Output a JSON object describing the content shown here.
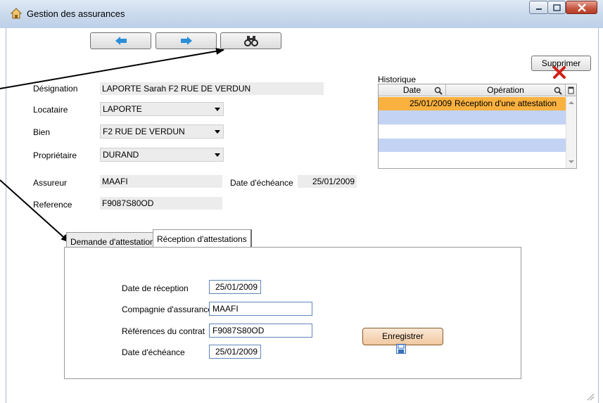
{
  "window": {
    "title": "Gestion des assurances",
    "close_color": "#c75a45"
  },
  "toolbar": {
    "prev_icon": "arrow-left-icon",
    "next_icon": "arrow-right-icon",
    "search_icon": "binoculars-icon",
    "accent": "#2a8fd8"
  },
  "form": {
    "designation_label": "Désignation",
    "designation_value": "LAPORTE Sarah F2 RUE DE VERDUN",
    "locataire_label": "Locataire",
    "locataire_value": "LAPORTE",
    "bien_label": "Bien",
    "bien_value": "F2 RUE DE VERDUN",
    "proprietaire_label": "Propriétaire",
    "proprietaire_value": "DURAND",
    "assureur_label": "Assureur",
    "assureur_value": "MAAFI",
    "echeance_label": "Date d'échéance",
    "echeance_value": "25/01/2009",
    "reference_label": "Reference",
    "reference_value": "F9087S80OD"
  },
  "history": {
    "delete_label": "Supprimer",
    "title": "Historique",
    "col_date": "Date",
    "col_operation": "Opération",
    "rows": [
      {
        "date": "25/01/2009",
        "operation": "Réception d'une attestation"
      }
    ],
    "selected_color": "#f9b13f",
    "stripe_color": "#c3d3f4"
  },
  "tabs": [
    {
      "label": "Demande d'attestation"
    },
    {
      "label": "Réception d'attestations"
    }
  ],
  "reception": {
    "date_label": "Date de réception",
    "date_value": "25/01/2009",
    "compagnie_label": "Compagnie d'assurance",
    "compagnie_value": "MAAFI",
    "references_label": "Références du contrat",
    "references_value": "F9087S80OD",
    "echeance_label": "Date d'échéance",
    "echeance_value": "25/01/2009",
    "save_label": "Enregistrer"
  }
}
